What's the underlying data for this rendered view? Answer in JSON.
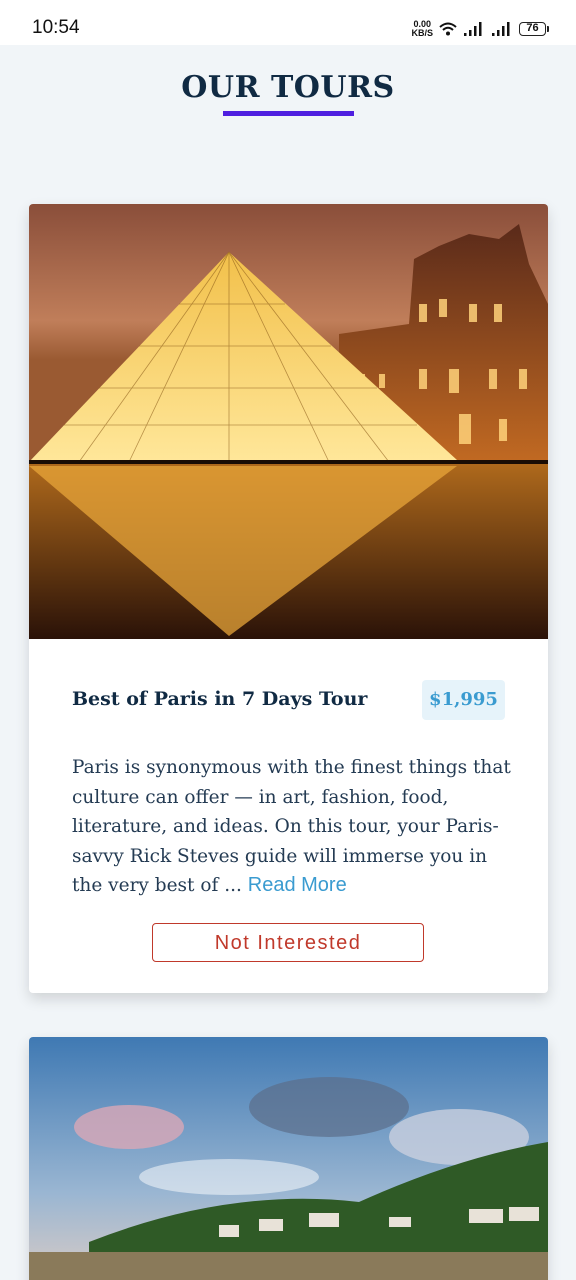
{
  "status_bar": {
    "time": "10:54",
    "net_speed_value": "0.00",
    "net_speed_unit": "KB/S",
    "battery": "76",
    "icons": [
      "wifi-icon",
      "signal-icon",
      "signal-icon",
      "battery-icon"
    ]
  },
  "page": {
    "title": "OUR TOURS",
    "accent_color": "#4f1fe0"
  },
  "tours": [
    {
      "name": "Best of Paris in 7 Days Tour",
      "price": "$1,995",
      "description": "Paris is synonymous with the finest things that culture can offer — in art, fashion, food, literature, and ideas. On this tour, your Paris-savvy Rick Steves guide will immerse you in the very best of ...",
      "read_more_label": "Read More",
      "not_interested_label": "Not Interested",
      "image": "louvre-pyramid-night-photo"
    },
    {
      "image": "coastal-village-sky-photo"
    }
  ]
}
